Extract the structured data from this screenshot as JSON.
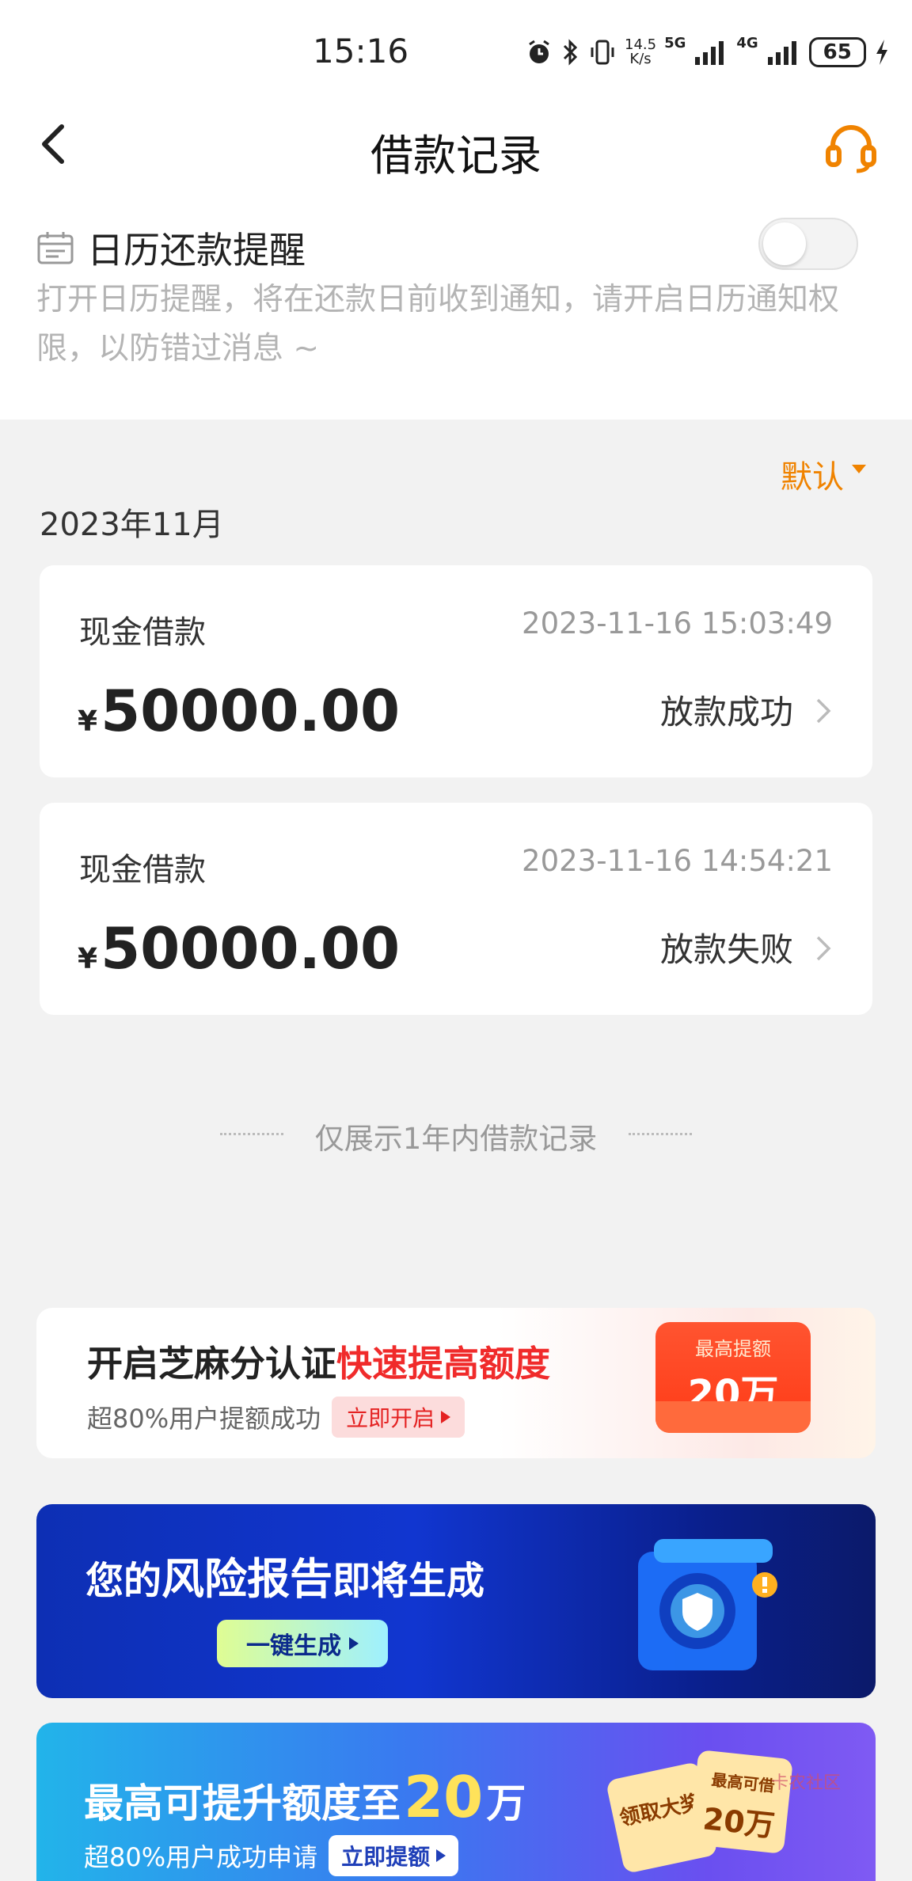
{
  "status_bar": {
    "time": "15:16",
    "speed_top": "14.5",
    "speed_bottom": "K/s",
    "net1": "5G",
    "net2": "4G",
    "battery": "65"
  },
  "nav": {
    "title": "借款记录"
  },
  "reminder": {
    "label": "日历还款提醒",
    "description": "打开日历提醒，将在还款日前收到通知，请开启日历通知权限，以防错过消息 ~",
    "enabled": false
  },
  "sort": {
    "label": "默认"
  },
  "month_header": "2023年11月",
  "records": [
    {
      "name": "现金借款",
      "datetime": "2023-11-16 15:03:49",
      "currency": "¥",
      "amount": "50000.00",
      "status": "放款成功"
    },
    {
      "name": "现金借款",
      "datetime": "2023-11-16 14:54:21",
      "currency": "¥",
      "amount": "50000.00",
      "status": "放款失败"
    }
  ],
  "footer_note": "仅展示1年内借款记录",
  "banners": {
    "zhima": {
      "title_black": "开启芝麻分认证",
      "title_red": "快速提高额度",
      "subtitle": "超80%用户提额成功",
      "button": "立即开启",
      "badge_top": "最高提额",
      "badge_amount": "20万"
    },
    "risk": {
      "title_pre": "您的",
      "title_main": "风险报告",
      "title_post": "即将生成",
      "button": "一键生成"
    },
    "raise": {
      "title_pre": "最高可提升额度至",
      "title_num": "20",
      "title_unit": "万",
      "subtitle": "超80%用户成功申请",
      "button": "立即提额",
      "coupon_left": "领取大奖",
      "coupon_right_top": "最高可借",
      "coupon_right_amount": "20万"
    }
  },
  "colors": {
    "accent": "#f08300",
    "danger": "#f02b2b",
    "page_bg": "#f2f2f2"
  }
}
